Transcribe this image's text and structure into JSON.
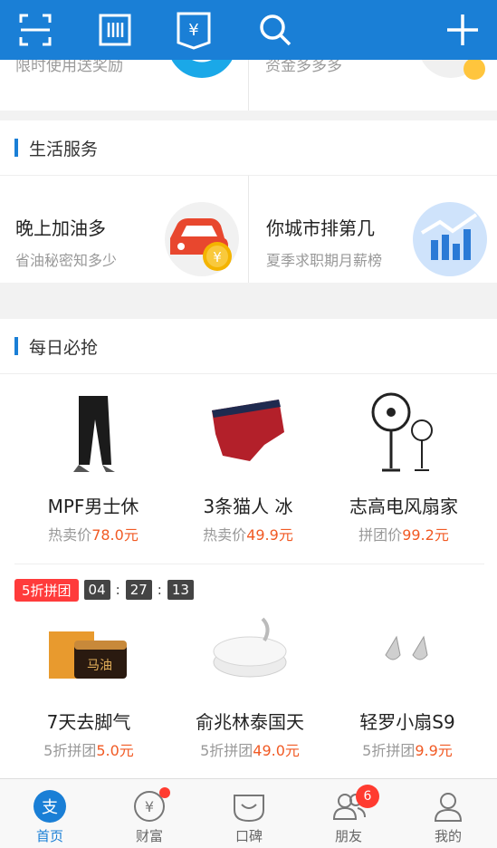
{
  "topbar": {
    "icons": [
      "scan-icon",
      "barcode-icon",
      "bill-icon",
      "search-icon",
      "add-icon"
    ],
    "bill_glyph": "¥"
  },
  "promo": {
    "left_sub": "限时使用送奖励",
    "right_sub": "资金多多多"
  },
  "life_services": {
    "title": "生活服务",
    "cards": [
      {
        "title": "晚上加油多",
        "desc": "省油秘密知多少",
        "icon": "car-coin-icon",
        "glyph": "¥"
      },
      {
        "title": "你城市排第几",
        "desc": "夏季求职期月薪榜",
        "icon": "bar-chart-icon"
      }
    ]
  },
  "daily": {
    "title": "每日必抢",
    "row1": [
      {
        "name": "MPF男士休",
        "price_label": "热卖价",
        "price": "78.0元",
        "icon": "pants-image"
      },
      {
        "name": "3条猫人  冰",
        "price_label": "热卖价",
        "price": "49.9元",
        "icon": "underwear-image"
      },
      {
        "name": "志高电风扇家",
        "price_label": "拼团价",
        "price": "99.2元",
        "icon": "fan-image"
      }
    ],
    "deal_tag": "5折拼团",
    "timer": [
      "04",
      "27",
      "13"
    ],
    "timer_sep": ":",
    "row2": [
      {
        "name": "7天去脚气",
        "price_label": "5折拼团",
        "price": "5.0元",
        "icon": "ointment-image",
        "label_on_box": "马油"
      },
      {
        "name": "俞兆林泰国天",
        "price_label": "5折拼团",
        "price": "49.0元",
        "icon": "pillow-image"
      },
      {
        "name": "轻罗小扇S9",
        "price_label": "5折拼团",
        "price": "9.9元",
        "icon": "earring-image"
      }
    ]
  },
  "tabbar": {
    "tabs": [
      {
        "label": "首页",
        "icon": "alipay-home-icon",
        "active": true,
        "glyph": "支"
      },
      {
        "label": "财富",
        "icon": "wealth-icon",
        "dot": true,
        "glyph": "¥"
      },
      {
        "label": "口碑",
        "icon": "koubei-icon"
      },
      {
        "label": "朋友",
        "icon": "friends-icon",
        "badge": "6"
      },
      {
        "label": "我的",
        "icon": "profile-icon"
      }
    ]
  },
  "colors": {
    "brand": "#1a7fd6",
    "price": "#f15a24",
    "alert": "#ff3b30"
  }
}
